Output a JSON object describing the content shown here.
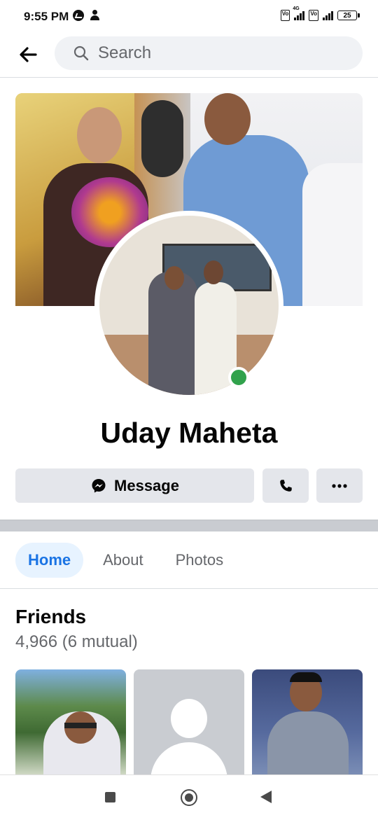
{
  "status_bar": {
    "time": "9:55 PM",
    "network": "4G",
    "volte1": "Vo LTE",
    "volte2": "Vo LTE",
    "battery": "25"
  },
  "search": {
    "placeholder": "Search"
  },
  "profile": {
    "name": "Uday Maheta",
    "online": true,
    "online_color": "#31a24c"
  },
  "actions": {
    "message_label": "Message"
  },
  "tabs": [
    {
      "label": "Home",
      "active": true
    },
    {
      "label": "About",
      "active": false
    },
    {
      "label": "Photos",
      "active": false
    }
  ],
  "friends": {
    "title": "Friends",
    "count_text": "4,966 (6 mutual)"
  },
  "colors": {
    "accent": "#1b74e4",
    "button_bg": "#e4e6eb",
    "search_bg": "#f0f2f5",
    "active_tab_bg": "#e7f3ff"
  },
  "icons": {
    "back": "arrow-left-icon",
    "search": "search-icon",
    "messenger": "messenger-icon",
    "call": "phone-icon",
    "more": "more-dots-icon"
  }
}
